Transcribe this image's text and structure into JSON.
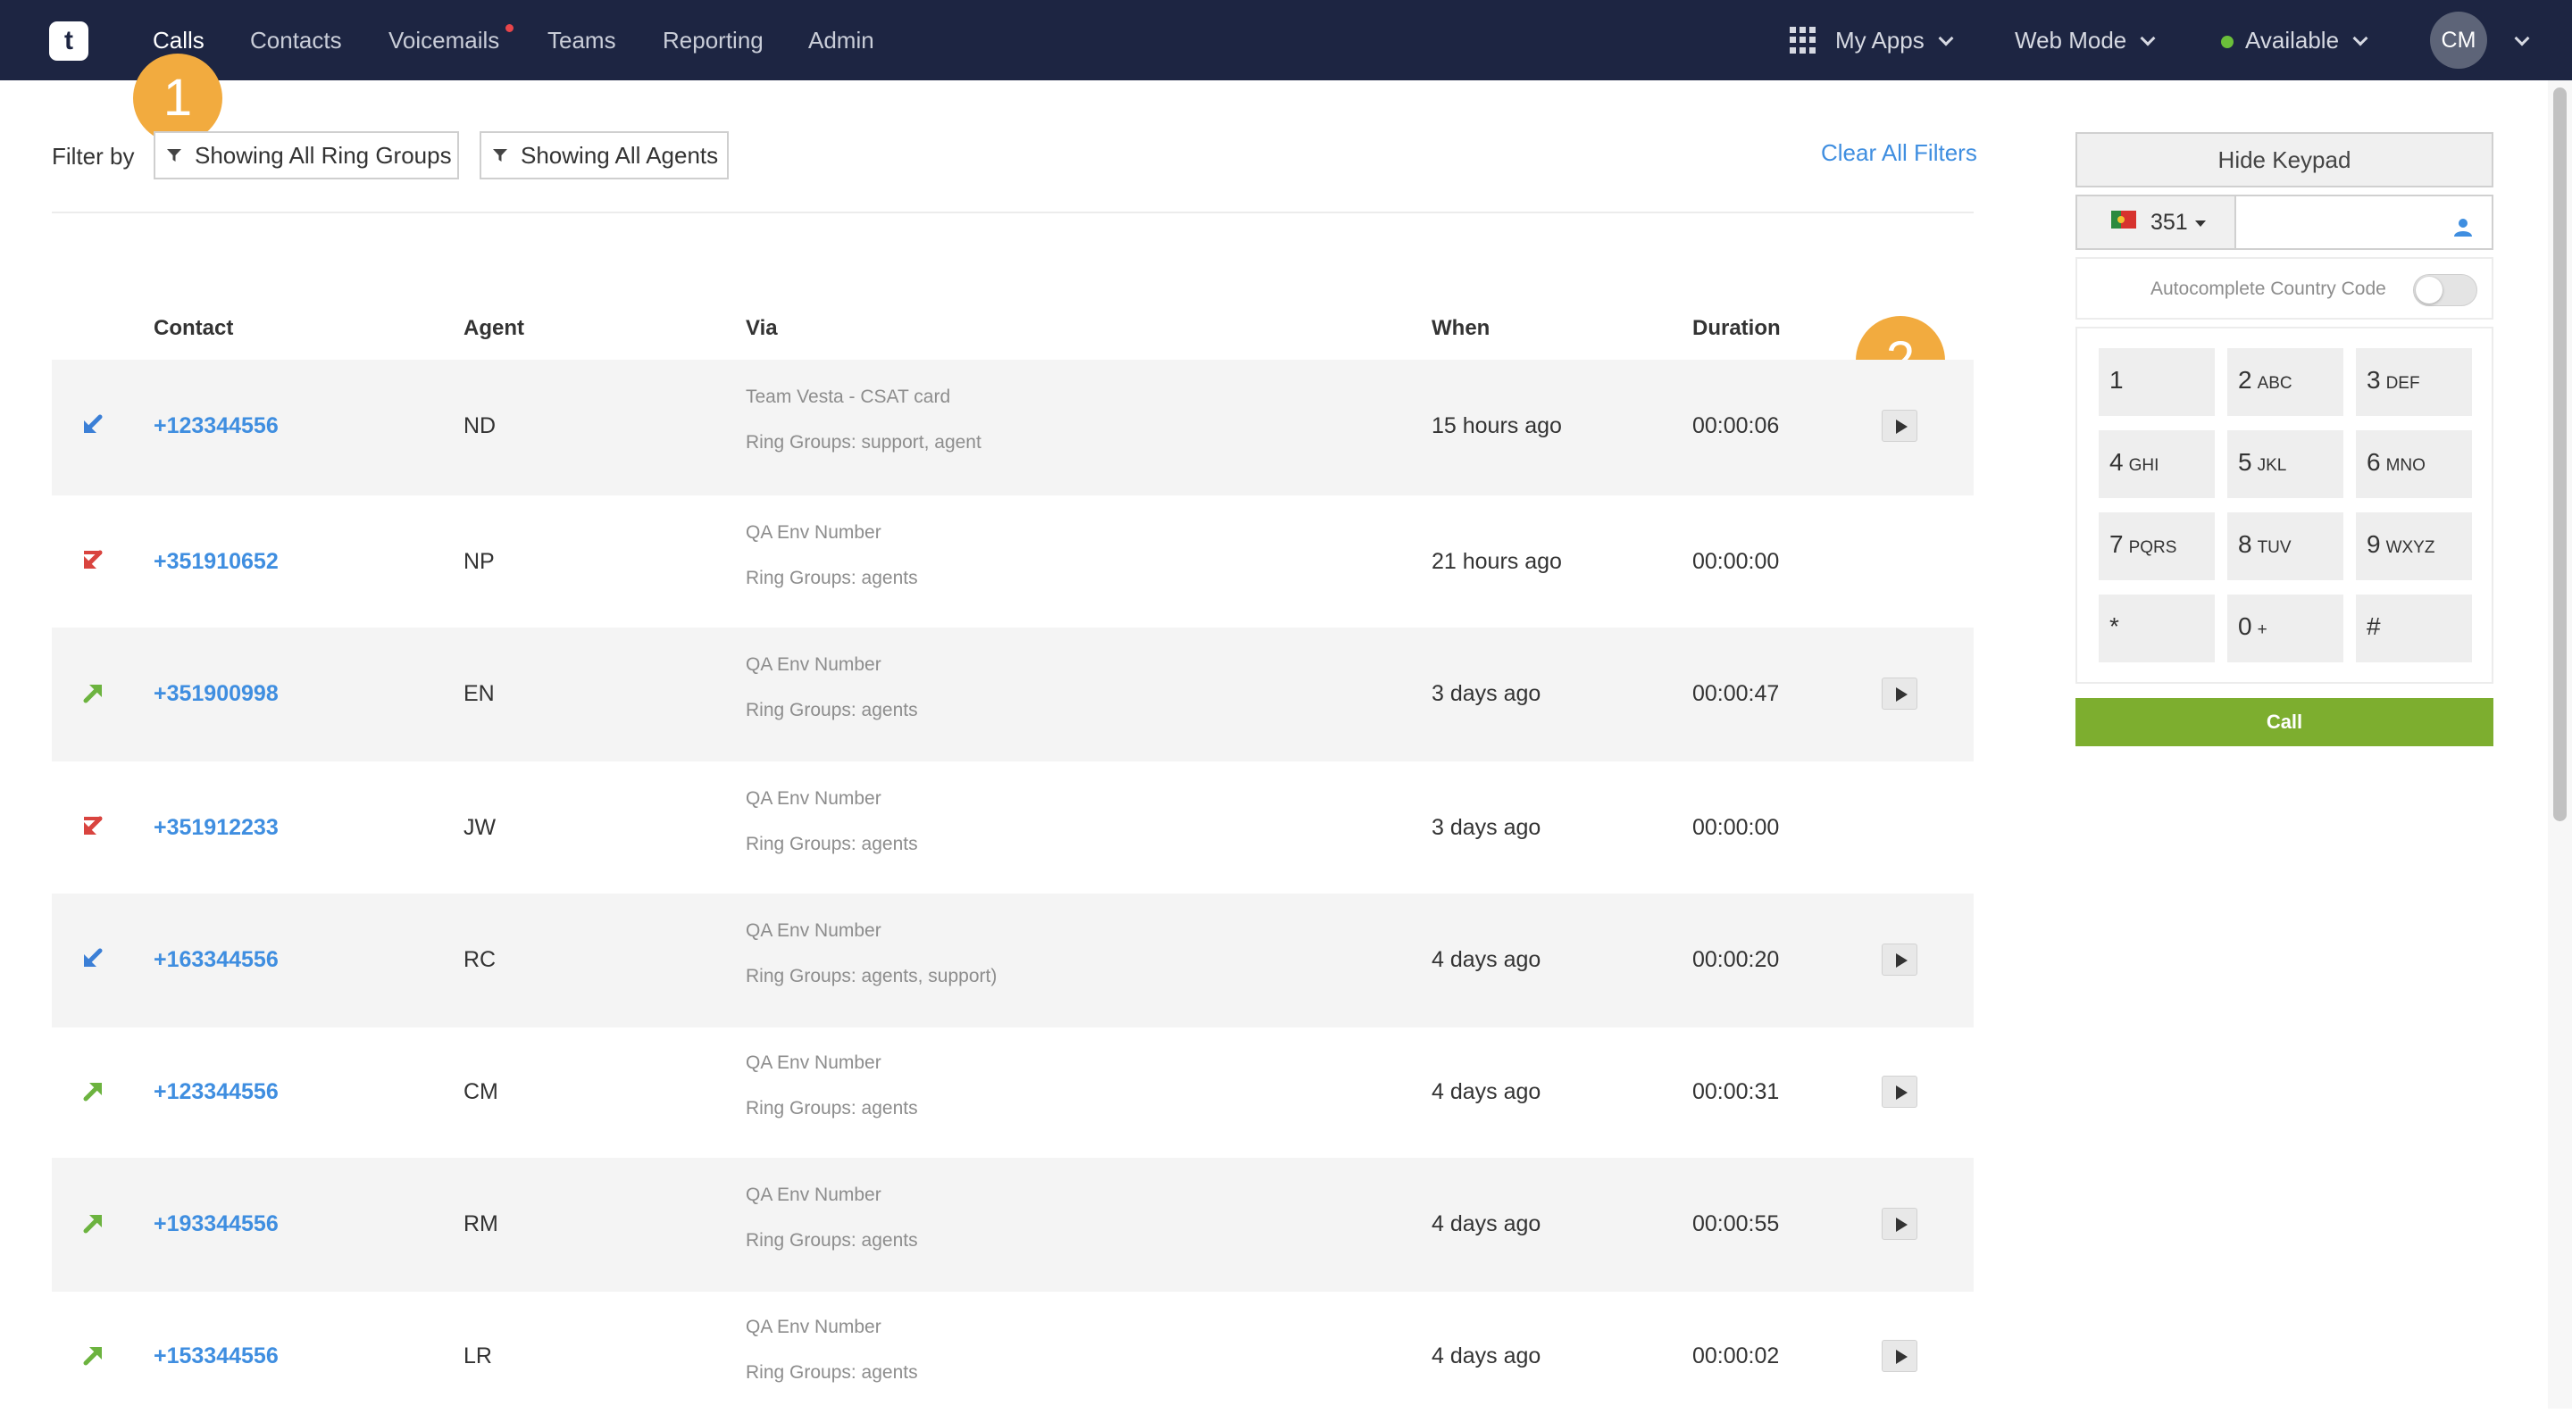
{
  "nav": {
    "logo": "t",
    "items": [
      {
        "label": "Calls",
        "active": true
      },
      {
        "label": "Contacts"
      },
      {
        "label": "Voicemails",
        "notification": true
      },
      {
        "label": "Teams"
      },
      {
        "label": "Reporting"
      },
      {
        "label": "Admin"
      }
    ],
    "my_apps": "My Apps",
    "mode": "Web Mode",
    "status": "Available",
    "avatar": "CM"
  },
  "badges": [
    "1",
    "2"
  ],
  "filters": {
    "label": "Filter by",
    "ring_groups": "Showing All Ring Groups",
    "agents": "Showing All Agents",
    "clear": "Clear All Filters"
  },
  "table": {
    "headers": {
      "contact": "Contact",
      "agent": "Agent",
      "via": "Via",
      "when": "When",
      "duration": "Duration"
    },
    "rows": [
      {
        "direction": "inbound",
        "contact": "+123344556",
        "agent": "ND",
        "via_line1": "Team Vesta - CSAT card",
        "via_line2": "Ring Groups: support, agent",
        "when": "15 hours ago",
        "duration": "00:00:06",
        "recording": true
      },
      {
        "direction": "missed",
        "contact": "+351910652",
        "agent": "NP",
        "via_line1": "QA Env Number",
        "via_line2": "Ring Groups: agents",
        "when": "21 hours ago",
        "duration": "00:00:00",
        "recording": false
      },
      {
        "direction": "outbound",
        "contact": "+351900998",
        "agent": "EN",
        "via_line1": "QA Env Number",
        "via_line2": "Ring Groups: agents",
        "when": "3 days ago",
        "duration": "00:00:47",
        "recording": true
      },
      {
        "direction": "missed",
        "contact": "+351912233",
        "agent": "JW",
        "via_line1": "QA Env Number",
        "via_line2": "Ring Groups: agents",
        "when": "3 days ago",
        "duration": "00:00:00",
        "recording": false
      },
      {
        "direction": "inbound",
        "contact": "+163344556",
        "agent": "RC",
        "via_line1": "QA Env Number",
        "via_line2": "Ring Groups: agents, support)",
        "when": "4 days ago",
        "duration": "00:00:20",
        "recording": true
      },
      {
        "direction": "outbound",
        "contact": "+123344556",
        "agent": "CM",
        "via_line1": "QA Env Number",
        "via_line2": "Ring Groups: agents",
        "when": "4 days ago",
        "duration": "00:00:31",
        "recording": true
      },
      {
        "direction": "outbound",
        "contact": "+193344556",
        "agent": "RM",
        "via_line1": "QA Env Number",
        "via_line2": "Ring Groups: agents",
        "when": "4 days ago",
        "duration": "00:00:55",
        "recording": true
      },
      {
        "direction": "outbound",
        "contact": "+153344556",
        "agent": "LR",
        "via_line1": "QA Env Number",
        "via_line2": "Ring Groups: agents",
        "when": "4 days ago",
        "duration": "00:00:02",
        "recording": true
      }
    ]
  },
  "keypad": {
    "hide_label": "Hide Keypad",
    "country_code": "351",
    "phone_value": "",
    "autocomplete_label": "Autocomplete Country Code",
    "autocomplete_on": false,
    "keys": [
      {
        "digit": "1",
        "letters": ""
      },
      {
        "digit": "2",
        "letters": "ABC"
      },
      {
        "digit": "3",
        "letters": "DEF"
      },
      {
        "digit": "4",
        "letters": "GHI"
      },
      {
        "digit": "5",
        "letters": "JKL"
      },
      {
        "digit": "6",
        "letters": "MNO"
      },
      {
        "digit": "7",
        "letters": "PQRS"
      },
      {
        "digit": "8",
        "letters": "TUV"
      },
      {
        "digit": "9",
        "letters": "WXYZ"
      },
      {
        "digit": "*",
        "letters": ""
      },
      {
        "digit": "0",
        "letters": "+"
      },
      {
        "digit": "#",
        "letters": ""
      }
    ],
    "call_label": "Call"
  },
  "colors": {
    "nav_bg": "#1d2542",
    "link": "#3f8ee0",
    "call_green": "#7dae2f",
    "badge": "#f2ab3f",
    "inbound": "#3b7fd6",
    "outbound": "#6cb33f",
    "missed": "#d9443f"
  }
}
